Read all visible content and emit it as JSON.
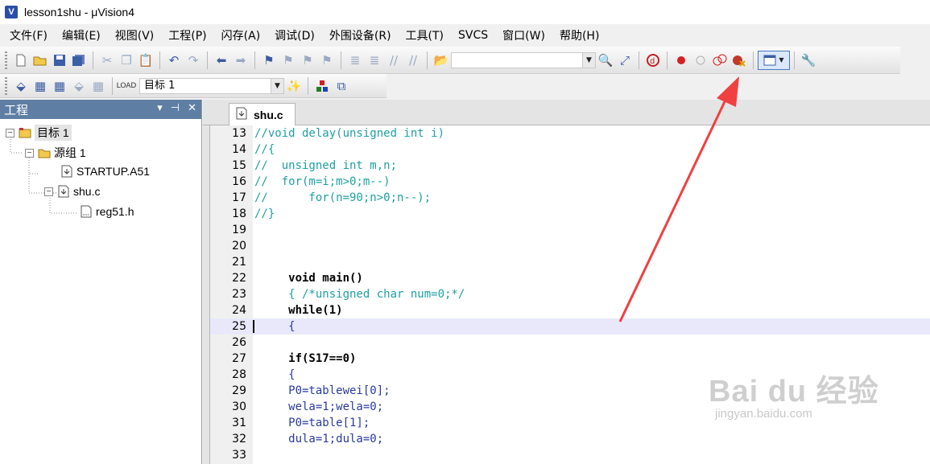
{
  "window": {
    "title": "lesson1shu  - μVision4",
    "app_icon_letter": "V"
  },
  "menu": [
    "文件(F)",
    "编辑(E)",
    "视图(V)",
    "工程(P)",
    "闪存(A)",
    "调试(D)",
    "外围设备(R)",
    "工具(T)",
    "SVCS",
    "窗口(W)",
    "帮助(H)"
  ],
  "toolbar2": {
    "target_select": "目标 1"
  },
  "project_panel": {
    "title": "工程",
    "tree": {
      "target": "目标 1",
      "group": "源组 1",
      "startup": "STARTUP.A51",
      "source": "shu.c",
      "header": "reg51.h"
    }
  },
  "editor": {
    "tab": "shu.c",
    "lines": [
      {
        "num": "13",
        "text": "//void delay(unsigned int i)",
        "style": "comment"
      },
      {
        "num": "14",
        "text": "//{",
        "style": "comment"
      },
      {
        "num": "15",
        "text": "//  unsigned int m,n;",
        "style": "comment"
      },
      {
        "num": "16",
        "text": "//  for(m=i;m>0;m--)",
        "style": "comment"
      },
      {
        "num": "17",
        "text": "//      for(n=90;n>0;n--);",
        "style": "comment"
      },
      {
        "num": "18",
        "text": "//}",
        "style": "comment"
      },
      {
        "num": "19",
        "text": "",
        "style": "plain"
      },
      {
        "num": "20",
        "text": "",
        "style": "plain"
      },
      {
        "num": "21",
        "text": "",
        "style": "plain"
      },
      {
        "num": "22",
        "text": "     void main()",
        "style": "plain"
      },
      {
        "num": "23",
        "text": "     { /*unsigned char num=0;*/",
        "style": "comment"
      },
      {
        "num": "24",
        "text": "     while(1)",
        "style": "plain"
      },
      {
        "num": "25",
        "text": "     {",
        "style": "plain"
      },
      {
        "num": "26",
        "text": "",
        "style": "plain"
      },
      {
        "num": "27",
        "text": "     if(S17==0)",
        "style": "plain"
      },
      {
        "num": "28",
        "text": "     {",
        "style": "plain"
      },
      {
        "num": "29",
        "text": "     P0=tablewei[0];",
        "style": "plain"
      },
      {
        "num": "30",
        "text": "     wela=1;wela=0;",
        "style": "plain"
      },
      {
        "num": "31",
        "text": "     P0=table[1];",
        "style": "plain"
      },
      {
        "num": "32",
        "text": "     dula=1;dula=0;",
        "style": "plain"
      },
      {
        "num": "33",
        "text": "",
        "style": "plain"
      }
    ],
    "current_line": "25"
  },
  "watermark": {
    "main": "Bai du 经验",
    "sub": "jingyan.baidu.com"
  },
  "colors": {
    "accent_arrow": "#f04040",
    "panel_header": "#5e7fa3",
    "current_line": "#e8e8fa"
  }
}
